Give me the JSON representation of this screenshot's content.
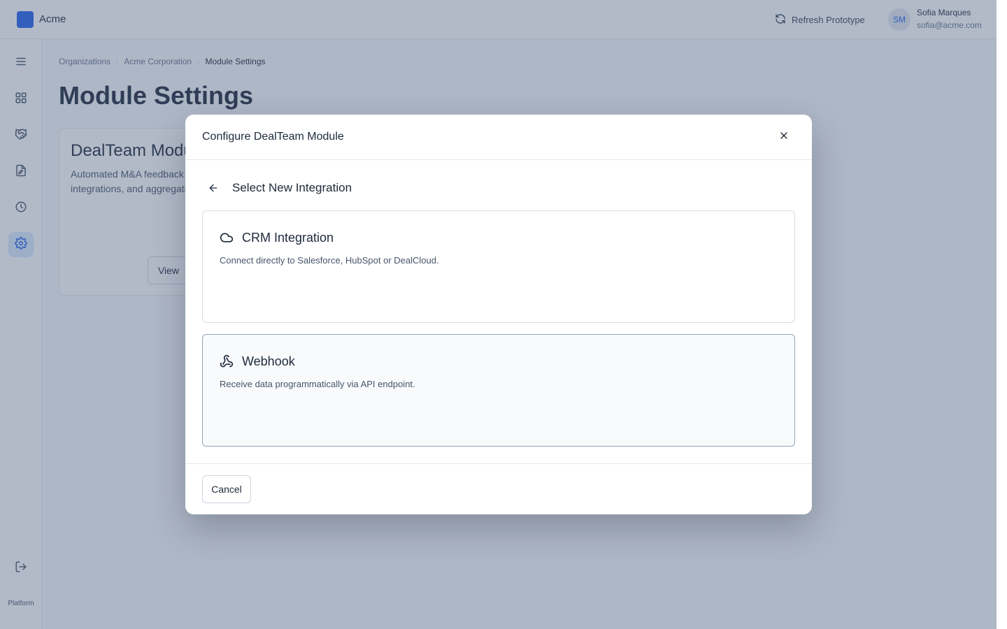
{
  "app": {
    "name": "Acme",
    "brand_color": "#2563eb"
  },
  "header": {
    "refresh_label": "Refresh Prototype",
    "user": {
      "initials": "SM",
      "name": "Sofia Marques",
      "email": "sofia@acme.com"
    }
  },
  "sidebar": {
    "items": [
      {
        "icon": "menu-icon"
      },
      {
        "icon": "dashboard-grid-icon"
      },
      {
        "icon": "handshake-icon"
      },
      {
        "icon": "document-edit-icon"
      },
      {
        "icon": "clock-history-icon"
      },
      {
        "icon": "gear-icon",
        "active": true
      },
      {
        "icon": "logout-icon"
      }
    ],
    "footer_label": "Platform"
  },
  "breadcrumb": [
    "Organizations",
    "Acme Corporation",
    "Module Settings"
  ],
  "page": {
    "title": "Module Settings"
  },
  "module_card": {
    "title": "DealTeam Module",
    "description": "Automated M&A feedback collection with CRM integrations, and aggregation",
    "button_label": "View"
  },
  "modal": {
    "title": "Configure DealTeam Module",
    "subheading": "Select New Integration",
    "options": [
      {
        "icon": "cloud-icon",
        "title": "CRM Integration",
        "description": "Connect directly to Salesforce, HubSpot or DealCloud."
      },
      {
        "icon": "webhook-icon",
        "title": "Webhook",
        "description": "Receive data programmatically via API endpoint."
      }
    ],
    "cancel_label": "Cancel"
  }
}
